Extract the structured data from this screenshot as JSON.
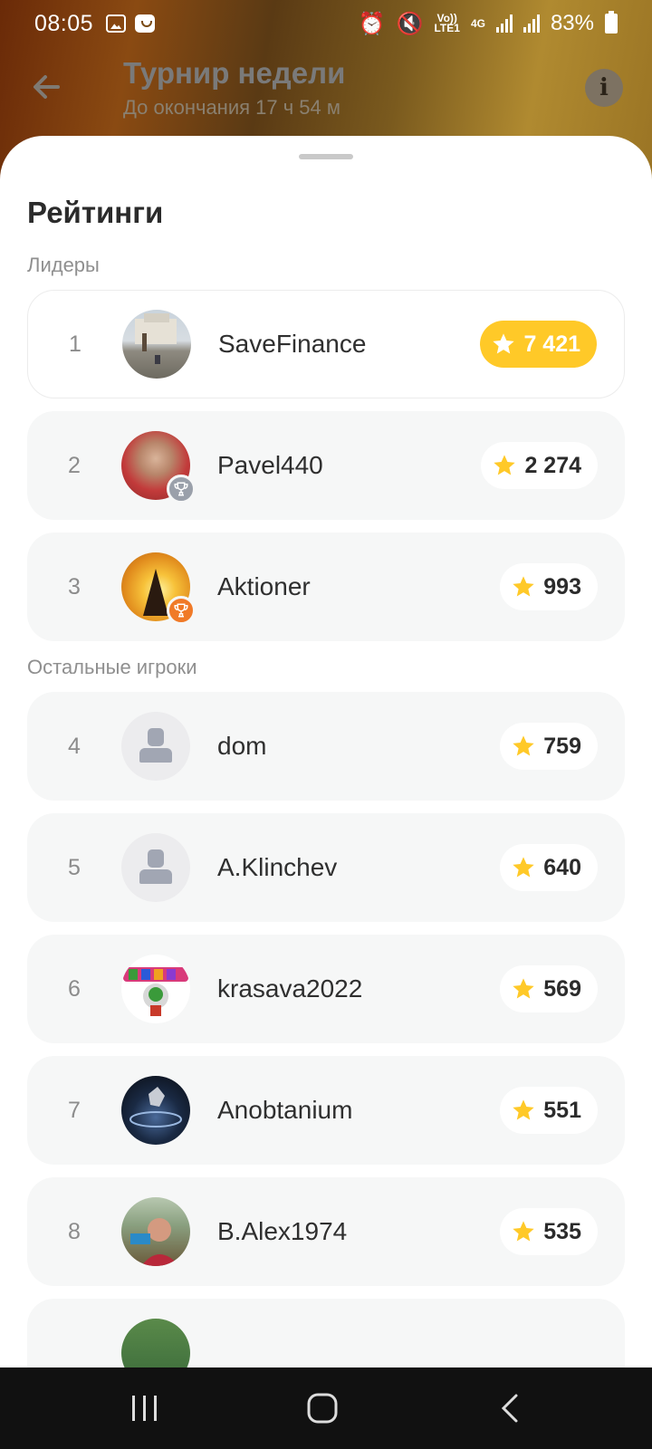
{
  "status_bar": {
    "time": "08:05",
    "network": "4G",
    "lte": "LTE1",
    "volte": "Vo))",
    "battery": "83%"
  },
  "header": {
    "title": "Турнир недели",
    "subtitle": "До окончания 17 ч 54 м",
    "back_icon": "arrow-left-icon",
    "info_icon": "info-icon"
  },
  "sheet": {
    "title": "Рейтинги",
    "leaders_label": "Лидеры",
    "others_label": "Остальные игроки"
  },
  "leaders": [
    {
      "rank": "1",
      "name": "SaveFinance",
      "score": "7 421"
    },
    {
      "rank": "2",
      "name": "Pavel440",
      "score": "2 274"
    },
    {
      "rank": "3",
      "name": "Aktioner",
      "score": "993"
    }
  ],
  "others": [
    {
      "rank": "4",
      "name": "dom",
      "score": "759"
    },
    {
      "rank": "5",
      "name": "A.Klinchev",
      "score": "640"
    },
    {
      "rank": "6",
      "name": "krasava2022",
      "score": "569"
    },
    {
      "rank": "7",
      "name": "Anobtanium",
      "score": "551"
    },
    {
      "rank": "8",
      "name": "B.Alex1974",
      "score": "535"
    }
  ],
  "colors": {
    "gold": "#ffc928",
    "silver_badge": "#9aa0aa",
    "bronze_badge": "#f07a28",
    "star": "#ffc928"
  }
}
